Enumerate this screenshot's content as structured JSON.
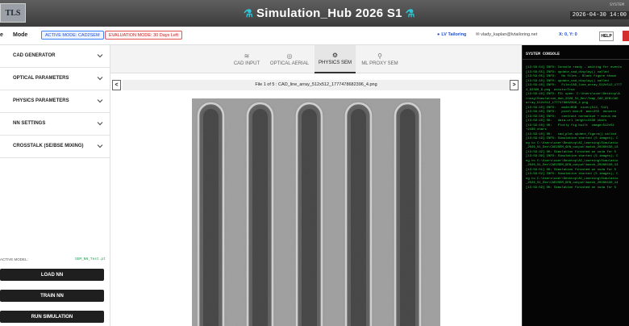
{
  "window": {
    "title": "Simulation_Hub 2026 S1",
    "logo_text": "TLS",
    "time_label": "SYSTEM",
    "time": "2026-04-30 14:00"
  },
  "modebar": {
    "mode_label": "Mode",
    "active_mode": "ACTIVE MODE: CAD2SEM",
    "evaluation_mode": "EVALUATION MODE: 30 Days Left",
    "tailoring": "LV Tailoring",
    "email": "vlady_kaplan@lvtailoring.net",
    "coords": "X: 0, Y: 0",
    "help": "HELP"
  },
  "sidebar": {
    "sections": [
      "CAD GENERATOR",
      "OPTICAL PARAMETERS",
      "PHYSICS PARAMETERS",
      "NN SETTINGS",
      "CROSSTALK (SE/BSE MIXING)"
    ],
    "active_model_label": "ACTIVE MODEL:",
    "active_model_value": "SEM_NN_Test.pt",
    "buttons": {
      "load": "LOAD NN",
      "train": "TRAIN NN",
      "run": "RUN SIMULATION"
    }
  },
  "tabs": [
    {
      "label": "CAD INPUT",
      "icon": "layers-icon"
    },
    {
      "label": "OPTICAL AERIAL",
      "icon": "aerial-icon"
    },
    {
      "label": "PHYSICS SEM",
      "icon": "settings-icon"
    },
    {
      "label": "ML PROXY SEM",
      "icon": "location-pin-icon"
    }
  ],
  "viewer": {
    "file_label": "File 1 of 5 : CAD_line_array_512x512_1777478682396_4.png",
    "prev": "<",
    "next": ">"
  },
  "console": {
    "title": "SYSTEM CONSOLE",
    "log": "[13:58:54] INFO: Console ready - waiting for events\n[13:58:55] INFO: update_cad_display() called\n[13:59:05] INFO:   No files - Blank figure shown\n[13:59:10] INFO: update_cad_display() called\n[13:59:10] INFO:   File=CAD_line_array_512x512_1777\n4_82396_6.png  exists=True\n[13:59:10] INFO: PIL open: C:\\Users\\user\\Desktop\\A\nrning\\Simulation_Hub_2026_S1_Dev\\Temp_CAD_GEN\\CAD\narray_512x512_1777478682396_4.png\n[13:59:10] INFO:   mode=RGB  size=(512, 512)\n[13:59:10] INFO:   pixel min=0  max=255  nonzero\n[13:59:10] INFO:   contrast normalize + minus ma\n[13:59:10] OK:   data-url length=2436 chars\n[13:59:10] OK:   Plotly fig built  image=512x51\n+2436 chars\n[13:59:10] OK:   cad_plot.update_figure() called\n[13:59:19] INFO: Simulation started (5 images), C\nng to C:\\Users\\user\\Desktop\\AI_Learning\\Simulatio\n_2026_S1_Dev\\CAD2SEM_GEN_output\\batch_20260430_13\n[13:59:32] OK: Simulation finished on cuda for 5\n[13:59:39] INFO: Simulation started (5 images), C\nng to C:\\Users\\user\\Desktop\\AI_Learning\\Simulatio\n_2026_S1_Dev\\CAD2SEM_GEN_output\\batch_20260430_13\n[13:59:51] OK: Simulation finished on cuda for 5\n[13:59:52] INFO: Simulation started (5 images), C\nng to C:\\Users\\user\\Desktop\\AI_Learning\\Simulatio\n_2026_S1_Dev\\CAD2SEM_GEN_output\\batch_20260430_14\n[13:59:59] OK: Simulation finished on cuda for 5"
  },
  "colors": {
    "titlebar": "#474747",
    "accent_blue": "#1d4ed8",
    "eval_red": "#c62828",
    "console_green": "#2fd44a",
    "sidebar_button": "#1f1f1f"
  }
}
